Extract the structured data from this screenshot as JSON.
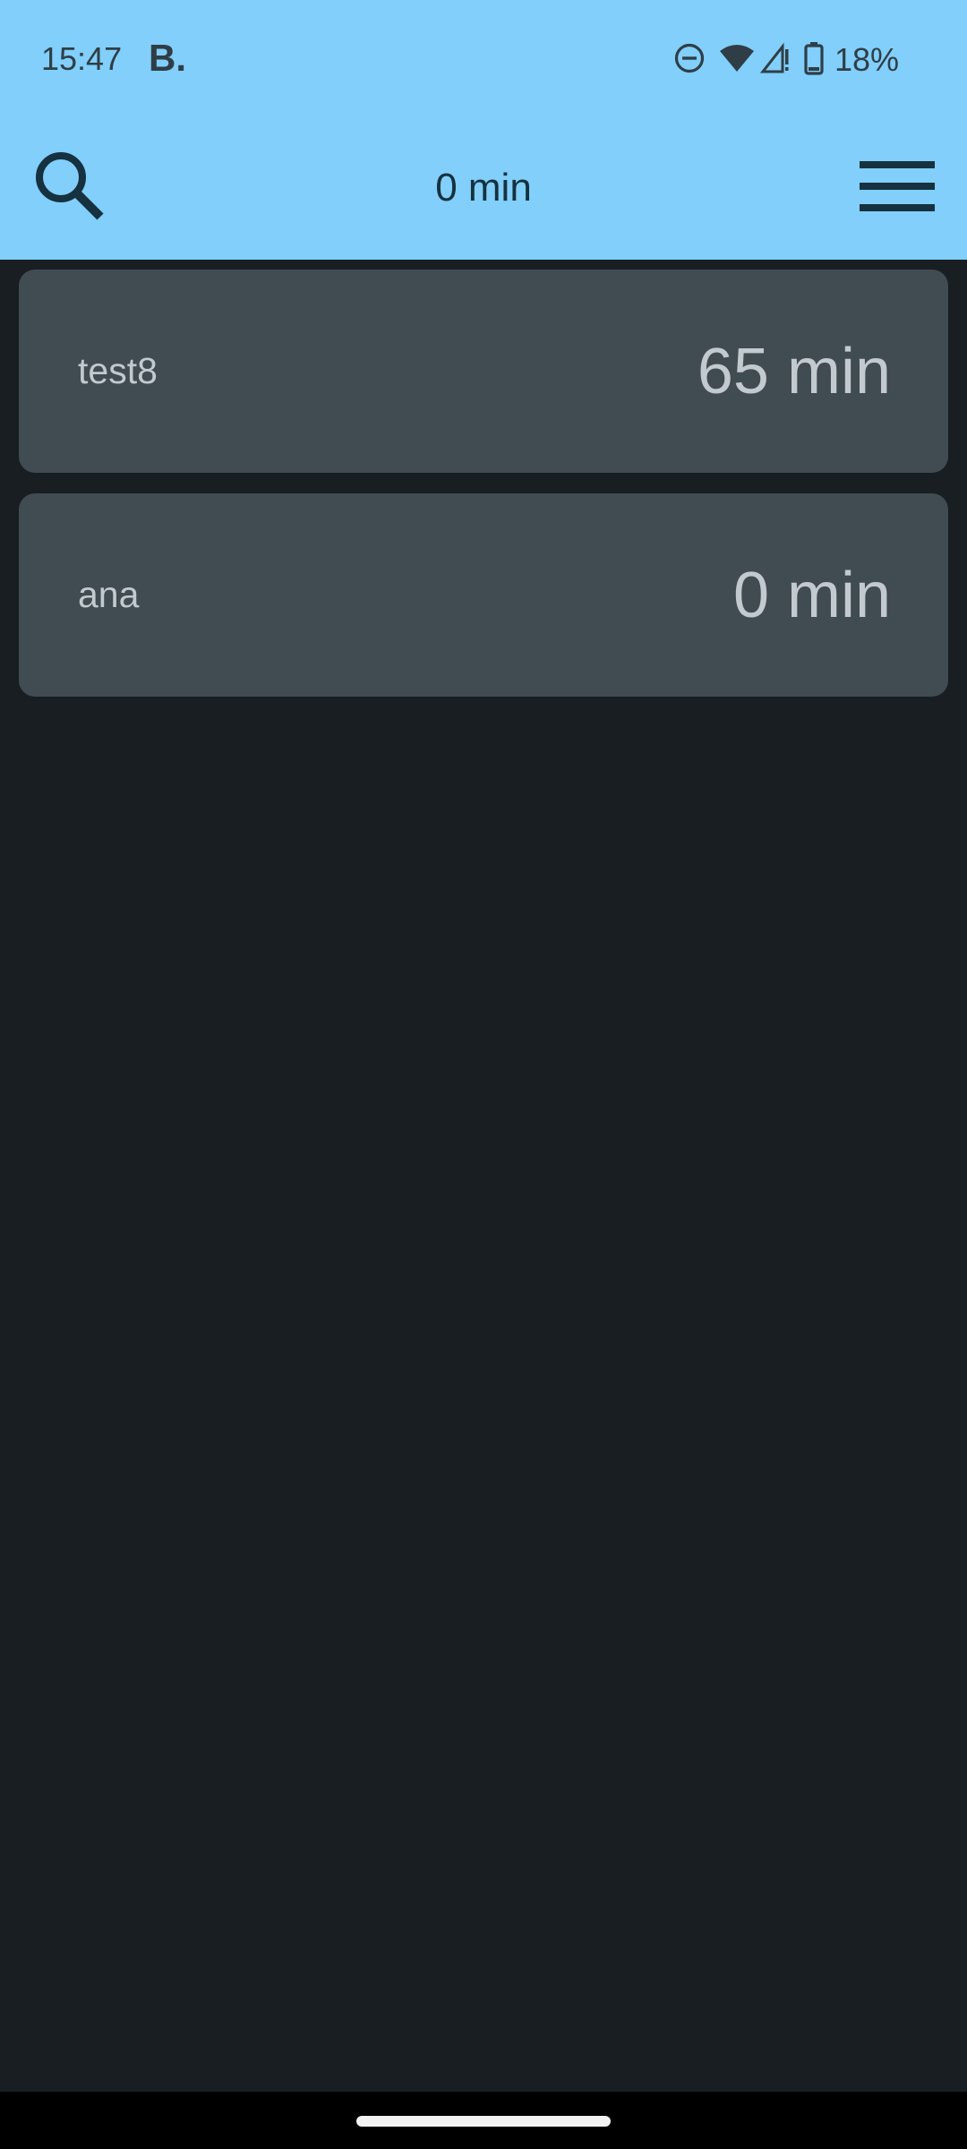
{
  "status_bar": {
    "time": "15:47",
    "app_icon_letter": "B.",
    "icons": [
      "do-not-disturb-icon",
      "wifi-icon",
      "cellular-signal-icon",
      "battery-icon"
    ],
    "battery_percent": "18%"
  },
  "app_bar": {
    "title": "0 min",
    "search_icon": "search-icon",
    "menu_icon": "hamburger-menu-icon"
  },
  "list": {
    "items": [
      {
        "name": "test8",
        "value": "65 min"
      },
      {
        "name": "ana",
        "value": "0 min"
      }
    ]
  },
  "colors": {
    "app_bar_bg": "#81cffa",
    "background": "#181e21",
    "card_bg": "#414b52",
    "card_text": "#c2c9cf",
    "title_text": "#16313f"
  }
}
